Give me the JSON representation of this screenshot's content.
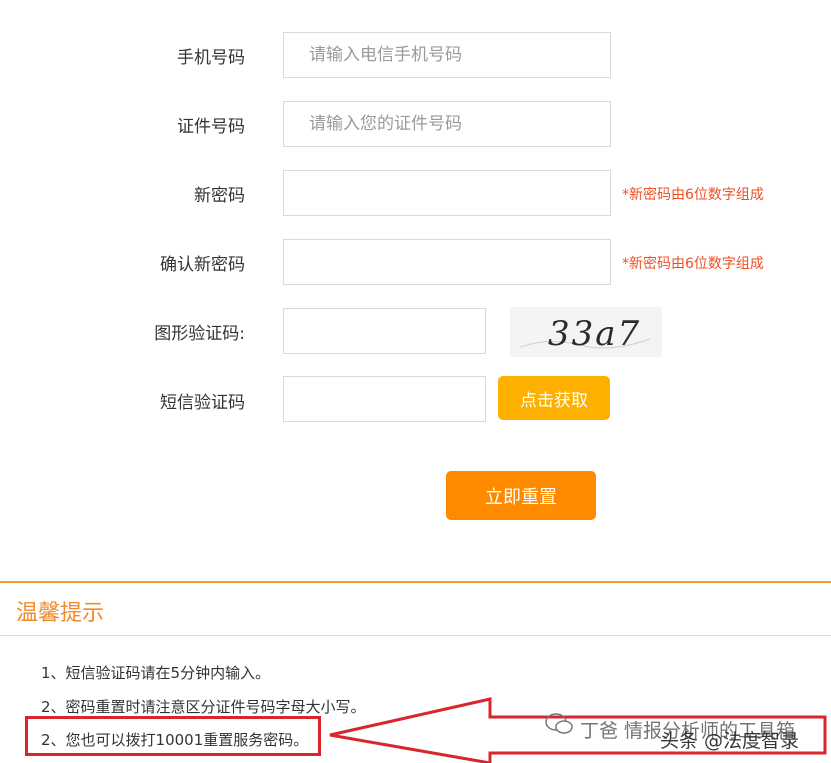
{
  "form": {
    "phone_label": "手机号码",
    "phone_placeholder": "请输入电信手机号码",
    "id_label": "证件号码",
    "id_placeholder": "请输入您的证件号码",
    "new_pwd_label": "新密码",
    "new_pwd_hint": "*新密码由6位数字组成",
    "confirm_pwd_label": "确认新密码",
    "confirm_pwd_hint": "*新密码由6位数字组成",
    "captcha_label": "图形验证码:",
    "captcha_text": "33a7",
    "sms_label": "短信验证码",
    "sms_button": "点击获取",
    "submit_button": "立即重置"
  },
  "tips": {
    "title": "温馨提示",
    "items": [
      "1、短信验证码请在5分钟内输入。",
      "2、密码重置时请注意区分证件号码字母大小写。",
      "2、您也可以拨打10001重置服务密码。"
    ]
  },
  "watermark": {
    "text": "丁爸 情报分析师的工具箱",
    "overlay": "头条 @法度智录"
  },
  "colors": {
    "orange": "#ff8a00",
    "yellow": "#fdb000",
    "hint_red": "#f04e23",
    "annotation_red": "#d8262c"
  }
}
